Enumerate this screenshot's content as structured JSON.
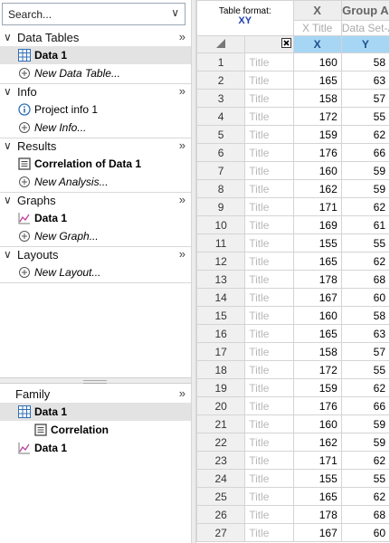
{
  "navigator": {
    "search_placeholder": "Search...",
    "sections": [
      {
        "title": "Data Tables",
        "items": [
          {
            "label": "Data 1",
            "bold": true,
            "italic": false,
            "icon": "table-icon",
            "selected": true
          },
          {
            "label": "New Data Table...",
            "bold": false,
            "italic": true,
            "icon": "add-icon",
            "selected": false
          }
        ]
      },
      {
        "title": "Info",
        "items": [
          {
            "label": "Project info 1",
            "bold": false,
            "italic": false,
            "icon": "info-icon",
            "selected": false
          },
          {
            "label": "New Info...",
            "bold": false,
            "italic": true,
            "icon": "add-icon",
            "selected": false
          }
        ]
      },
      {
        "title": "Results",
        "items": [
          {
            "label": "Correlation of Data 1",
            "bold": true,
            "italic": false,
            "icon": "results-icon",
            "selected": false
          },
          {
            "label": "New Analysis...",
            "bold": false,
            "italic": true,
            "icon": "add-icon",
            "selected": false
          }
        ]
      },
      {
        "title": "Graphs",
        "items": [
          {
            "label": "Data 1",
            "bold": true,
            "italic": false,
            "icon": "graph-icon",
            "selected": false
          },
          {
            "label": "New Graph...",
            "bold": false,
            "italic": true,
            "icon": "add-icon",
            "selected": false
          }
        ]
      },
      {
        "title": "Layouts",
        "items": [
          {
            "label": "New Layout...",
            "bold": false,
            "italic": true,
            "icon": "add-icon",
            "selected": false
          }
        ]
      }
    ],
    "expand_glyph": "»",
    "collapse_glyph": "∨"
  },
  "family": {
    "title": "Family",
    "items": [
      {
        "label": "Data 1",
        "icon": "table-icon",
        "level": 0,
        "selected": true
      },
      {
        "label": "Correlation",
        "icon": "results-icon",
        "level": 1,
        "selected": false
      },
      {
        "label": "Data 1",
        "icon": "graph-icon",
        "level": 0,
        "selected": false
      }
    ]
  },
  "sheet": {
    "table_format_label": "Table format:",
    "table_format_value": "XY",
    "x_header": "X",
    "group_header": "Group A",
    "x_title": "X Title",
    "dataset_title": "Data Set-A",
    "sub_x": "X",
    "sub_y": "Y",
    "row_title_placeholder": "Title",
    "rows": [
      {
        "n": "1",
        "x": "160",
        "y": "58"
      },
      {
        "n": "2",
        "x": "165",
        "y": "63"
      },
      {
        "n": "3",
        "x": "158",
        "y": "57"
      },
      {
        "n": "4",
        "x": "172",
        "y": "55"
      },
      {
        "n": "5",
        "x": "159",
        "y": "62"
      },
      {
        "n": "6",
        "x": "176",
        "y": "66"
      },
      {
        "n": "7",
        "x": "160",
        "y": "59"
      },
      {
        "n": "8",
        "x": "162",
        "y": "59"
      },
      {
        "n": "9",
        "x": "171",
        "y": "62"
      },
      {
        "n": "10",
        "x": "169",
        "y": "61"
      },
      {
        "n": "11",
        "x": "155",
        "y": "55"
      },
      {
        "n": "12",
        "x": "165",
        "y": "62"
      },
      {
        "n": "13",
        "x": "178",
        "y": "68"
      },
      {
        "n": "14",
        "x": "167",
        "y": "60"
      },
      {
        "n": "15",
        "x": "160",
        "y": "58"
      },
      {
        "n": "16",
        "x": "165",
        "y": "63"
      },
      {
        "n": "17",
        "x": "158",
        "y": "57"
      },
      {
        "n": "18",
        "x": "172",
        "y": "55"
      },
      {
        "n": "19",
        "x": "159",
        "y": "62"
      },
      {
        "n": "20",
        "x": "176",
        "y": "66"
      },
      {
        "n": "21",
        "x": "160",
        "y": "59"
      },
      {
        "n": "22",
        "x": "162",
        "y": "59"
      },
      {
        "n": "23",
        "x": "171",
        "y": "62"
      },
      {
        "n": "24",
        "x": "155",
        "y": "55"
      },
      {
        "n": "25",
        "x": "165",
        "y": "62"
      },
      {
        "n": "26",
        "x": "178",
        "y": "68"
      },
      {
        "n": "27",
        "x": "167",
        "y": "60"
      }
    ]
  },
  "colors": {
    "selected_column": "#a7d6f4",
    "xy_label": "#1f3fb0"
  }
}
